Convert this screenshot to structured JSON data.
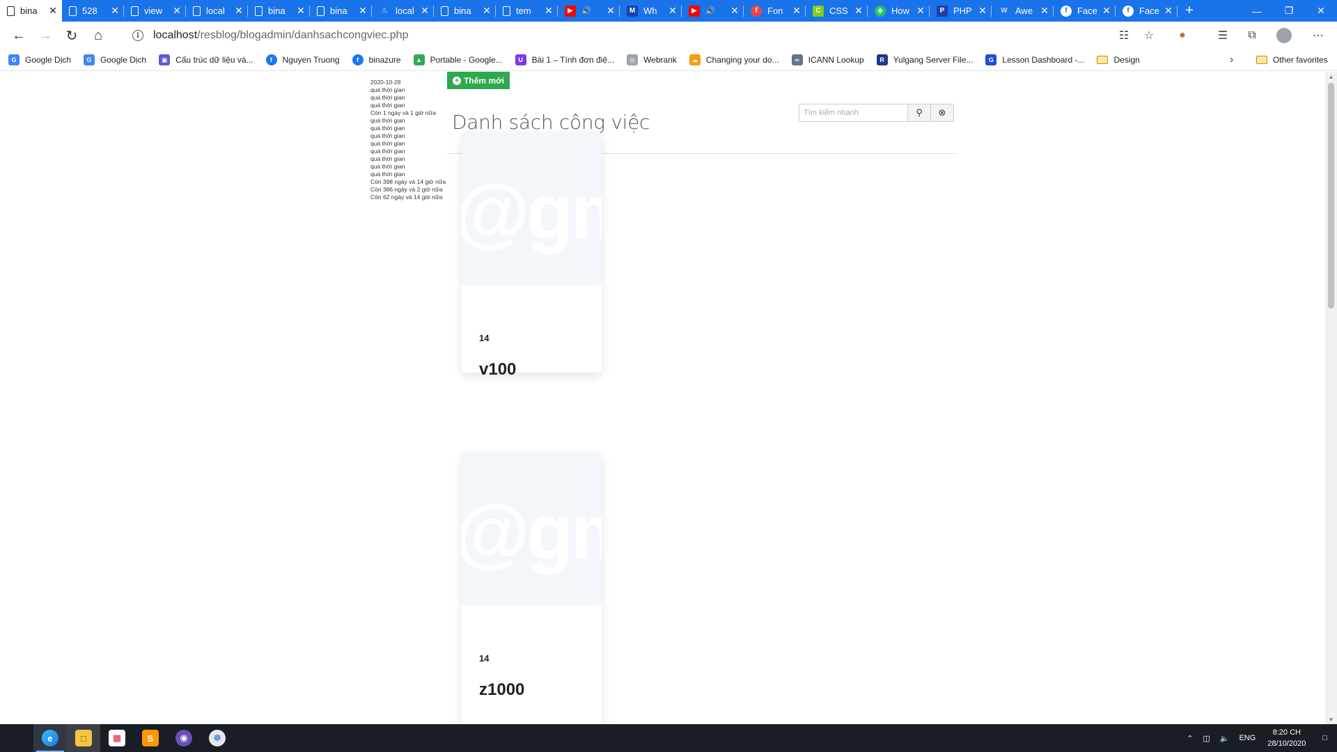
{
  "browser": {
    "tabs": [
      {
        "title": "bina",
        "icon": "document-icon",
        "active": true
      },
      {
        "title": "528",
        "icon": "document-icon"
      },
      {
        "title": "view",
        "icon": "document-icon"
      },
      {
        "title": "local",
        "icon": "document-icon"
      },
      {
        "title": "bina",
        "icon": "document-icon"
      },
      {
        "title": "bina",
        "icon": "document-icon"
      },
      {
        "title": "local",
        "icon": "warning-icon"
      },
      {
        "title": "bina",
        "icon": "document-icon"
      },
      {
        "title": "tem",
        "icon": "document-icon"
      },
      {
        "title": "",
        "icon": "youtube-icon",
        "audio": true
      },
      {
        "title": "Wh",
        "icon": "site-icon"
      },
      {
        "title": "",
        "icon": "youtube-icon",
        "audio": true
      },
      {
        "title": "Fon",
        "icon": "font-site-icon"
      },
      {
        "title": "CSS",
        "icon": "css-site-icon"
      },
      {
        "title": "How",
        "icon": "shield-site-icon"
      },
      {
        "title": "PHP",
        "icon": "php-site-icon"
      },
      {
        "title": "Awe",
        "icon": "w-site-icon"
      },
      {
        "title": "Face",
        "icon": "facebook-icon"
      },
      {
        "title": "Face",
        "icon": "facebook-icon"
      }
    ],
    "new_tab": "+",
    "url": {
      "host": "localhost",
      "path": "/resblog/blogadmin/danhsachcongviec.php"
    },
    "bookmarks": [
      {
        "label": "Google Dịch",
        "icon": "translate-icon",
        "color": "#4285f4"
      },
      {
        "label": "Google Dịch",
        "icon": "translate-icon",
        "color": "#4285f4"
      },
      {
        "label": "Cấu trúc dữ liệu và...",
        "icon": "book-icon",
        "color": "#5b5bd6"
      },
      {
        "label": "Nguyen Truong",
        "icon": "facebook-icon",
        "color": "#1877f2"
      },
      {
        "label": "binazure",
        "icon": "facebook-icon",
        "color": "#1877f2"
      },
      {
        "label": "Portable - Google...",
        "icon": "drive-icon",
        "color": "#34a853"
      },
      {
        "label": "Bài 1 – Tính đơn điệ...",
        "icon": "site-icon",
        "color": "#7c3aed"
      },
      {
        "label": "Webrank",
        "icon": "globe-icon",
        "color": "#9ca3af"
      },
      {
        "label": "Changing your do...",
        "icon": "cloud-icon",
        "color": "#f59e0b"
      },
      {
        "label": "ICANN Lookup",
        "icon": "link-icon",
        "color": "#64748b"
      },
      {
        "label": "Yulgang Server File...",
        "icon": "rz-icon",
        "color": "#1e3a8a"
      },
      {
        "label": "Lesson Dashboard -...",
        "icon": "g-icon",
        "color": "#1d4ed8"
      },
      {
        "label": "Design",
        "icon": "folder-icon",
        "color": "#c98b00"
      }
    ],
    "other_favorites": "Other favorites"
  },
  "page": {
    "debug_lines": [
      "2020-10-28",
      "quá thời gian",
      "quá thời gian",
      "quá thời gian",
      "Còn 1 ngày và 1 giờ nữa",
      "quá thời gian",
      "quá thời gian",
      "quá thời gian",
      "quá thời gian",
      "quá thời gian",
      "quá thời gian",
      "quá thời gian",
      "quá thời gian",
      "Còn 398 ngày và 14 giờ nữa",
      "Còn 386 ngày và 2 giờ nữa",
      "Còn 62 ngày và 14 giờ nữa"
    ],
    "add_button": "Thêm mới",
    "title": "Danh sách công việc",
    "search_placeholder": "Tìm kiếm nhanh",
    "cards": [
      {
        "number": "14",
        "name": "v100",
        "watermark": "@gm"
      },
      {
        "number": "14",
        "name": "z1000",
        "watermark": "@gm"
      }
    ]
  },
  "taskbar": {
    "apps": [
      "windows-start-icon",
      "edge-icon",
      "file-explorer-icon",
      "paint-icon",
      "sublime-icon",
      "obs-icon",
      "app-icon"
    ],
    "lang": "ENG",
    "time": "8:20 CH",
    "date": "28/10/2020"
  }
}
